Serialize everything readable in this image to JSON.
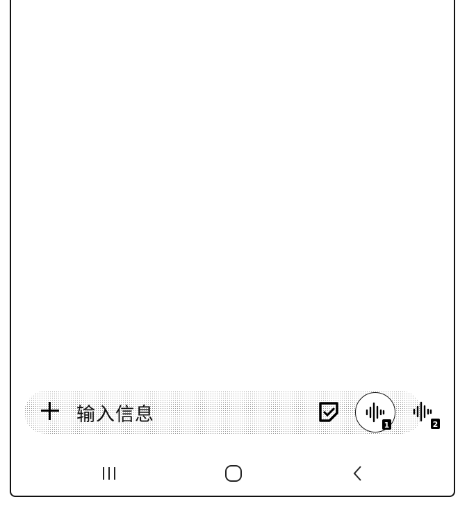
{
  "input": {
    "placeholder": "输入信息"
  },
  "icons": {
    "add": "plus-icon",
    "sticker": "sticker-icon",
    "voice_sim1": "voice-sim1-icon",
    "voice_sim2": "voice-sim2-icon"
  },
  "voice": {
    "sim1_badge": "1",
    "sim2_badge": "2"
  },
  "nav": {
    "recents": "recents-icon",
    "home": "home-icon",
    "back": "back-icon"
  }
}
